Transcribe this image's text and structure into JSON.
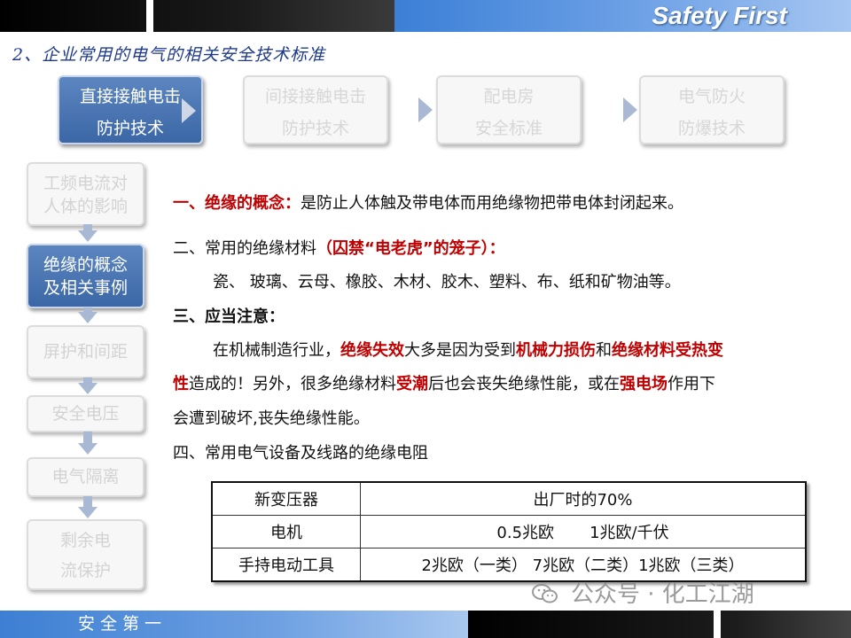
{
  "header": {
    "title": "Safety First"
  },
  "section_title": "2、企业常用的电气的相关安全技术标准",
  "top_tabs": [
    {
      "line1": "直接接触电击",
      "line2": "防护技术",
      "active": true
    },
    {
      "line1": "间接接触电击",
      "line2": "防护技术",
      "active": false
    },
    {
      "line1": "配电房",
      "line2": "安全标准",
      "active": false
    },
    {
      "line1": "电气防火",
      "line2": "防爆技术",
      "active": false
    }
  ],
  "side_items": [
    {
      "line1": "工频电流对",
      "line2": "人体的影响",
      "active": false
    },
    {
      "line1": "绝缘的概念",
      "line2": "及相关事例",
      "active": true
    },
    {
      "line1": "屏护和间距",
      "active": false
    },
    {
      "line1": "安全电压",
      "active": false
    },
    {
      "line1": "电气隔离",
      "active": false
    },
    {
      "line1": "剩余电",
      "line2": "流保护",
      "active": false
    }
  ],
  "content": {
    "p1_label": "一、绝缘的概念：",
    "p1_text": "是防止人体触及带电体而用绝缘物把带电体封闭起来。",
    "p2_text": "二、常用的绝缘材料",
    "p2_red": "（囚禁“电老虎”的笼子）：",
    "p2_list": "瓷、 玻璃、云母、橡胶、木材、胶木、塑料、布、纸和矿物油等。",
    "p3_label": "三、应当注意：",
    "p3_a": "在机械制造行业，",
    "p3_b": "绝缘失效",
    "p3_c": "大多是因为受到",
    "p3_d": "机械力损伤",
    "p3_e": "和",
    "p3_f": "绝缘材料受热变",
    "p3_g": "性",
    "p3_h": "造成的！另外，很多绝缘材料",
    "p3_i": "受潮",
    "p3_j": "后也会丧失绝缘性能，或在",
    "p3_k": "强电场",
    "p3_l": "作用下",
    "p3_m": "会遭到破坏,丧失绝缘性能。",
    "p4_text": "四、常用电气设备及线路的绝缘电阻"
  },
  "table": {
    "rows": [
      [
        "新变压器",
        "出厂时的70%"
      ],
      [
        "电机",
        "0.5兆欧       1兆欧/千伏"
      ],
      [
        "手持电动工具",
        "2兆欧（一类） 7兆欧（二类）1兆欧（三类）"
      ]
    ]
  },
  "watermark": {
    "text": "公众号 · 化工江湖",
    "icon": "wechat-icon"
  },
  "footer": {
    "text": "安全第一"
  }
}
